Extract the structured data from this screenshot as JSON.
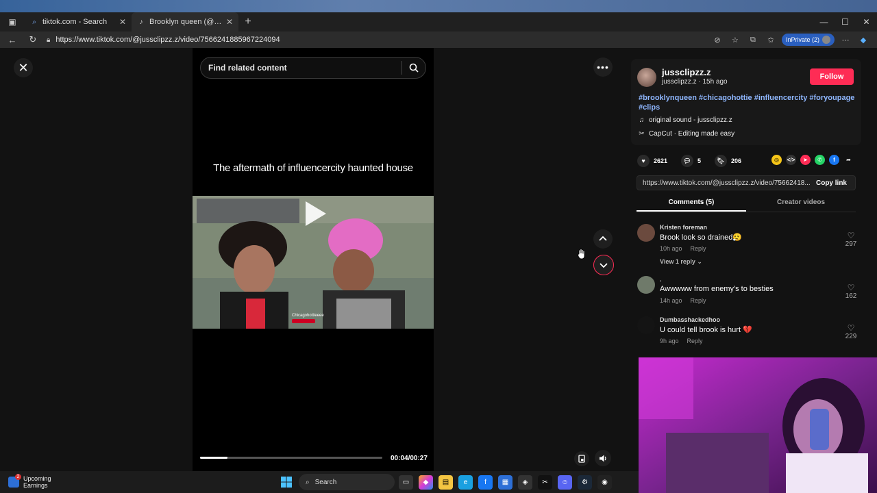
{
  "browser": {
    "tabs": [
      {
        "label": "tiktok.com - Search",
        "icon": "search-icon"
      },
      {
        "label": "Brooklyn queen (@brooklynqueen",
        "icon": "tiktok-icon"
      }
    ],
    "address": "https://www.tiktok.com/@jussclipzz.z/video/7566241885967224094",
    "inprivate_label": "InPrivate (2)"
  },
  "player": {
    "search_placeholder": "Find related content",
    "caption": "The aftermath of influencercity haunted house",
    "time": "00:04/00:27",
    "progress_fraction": 0.15,
    "watermark": "Chicagohottieeee"
  },
  "author": {
    "display_name": "jussclipzz.z",
    "subline": "jussclipzz.z · 15h ago",
    "follow_label": "Follow"
  },
  "description": {
    "hashtags": "#brooklynqueen #chicagohottie #influencercity #foryoupage #clips",
    "sound": "original sound - jussclipzz.z",
    "capcut": "CapCut · Editing made easy"
  },
  "stats": {
    "likes": "2621",
    "comments": "5",
    "saves": "206"
  },
  "share": {
    "link": "https://www.tiktok.com/@jussclipzz.z/video/75662418...",
    "copy_label": "Copy link"
  },
  "tabs": {
    "comments": "Comments (5)",
    "creator": "Creator videos"
  },
  "comments": [
    {
      "user": "Kristen foreman",
      "text": "Brook look so drained😮‍💨",
      "time": "10h ago",
      "reply": "Reply",
      "likes": "297",
      "replies": "View 1 reply ⌄",
      "avatar": "#6b4a3e"
    },
    {
      "user": ".",
      "text": "Awwwww from enemy's to besties",
      "time": "14h ago",
      "reply": "Reply",
      "likes": "162",
      "replies": "",
      "avatar": "#6f7a6a"
    },
    {
      "user": "Dumbasshackedhoo",
      "text": "U could tell brook is hurt 💔",
      "time": "9h ago",
      "reply": "Reply",
      "likes": "229",
      "replies": "",
      "avatar": "#141414"
    }
  ],
  "taskbar": {
    "weather_title": "Upcoming",
    "weather_sub": "Earnings",
    "badge": "2",
    "search_label": "Search"
  },
  "colors": {
    "accent": "#fe2c55",
    "hashtag": "#8fb7ff"
  }
}
